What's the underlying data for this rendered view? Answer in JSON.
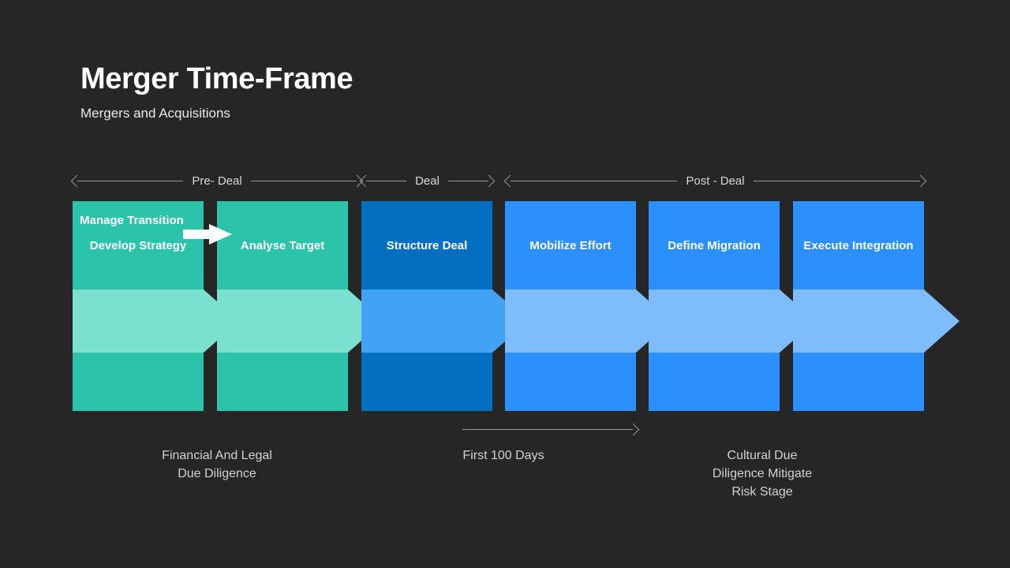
{
  "header": {
    "title": "Merger Time-Frame",
    "subtitle": "Mergers and Acquisitions"
  },
  "colors": {
    "background": "#262626",
    "teal": "#2BC4AB",
    "teal_light": "#7CE0D0",
    "blue_dark": "#046FC0",
    "blue_dark_light": "#42A3F5",
    "blue": "#2B8FFC",
    "blue_light": "#7FBCFB",
    "text_muted": "#d2d2d2",
    "rule": "#9b9b9b"
  },
  "phases": [
    {
      "label": "Pre- Deal"
    },
    {
      "label": "Deal"
    },
    {
      "label": "Post - Deal"
    }
  ],
  "stages": [
    {
      "title": "Develop\nStrategy",
      "fill": "#2BC4AB",
      "band": "#7CE0D0"
    },
    {
      "title": "Analyse\nTarget",
      "fill": "#2BC4AB",
      "band": "#7CE0D0"
    },
    {
      "title": "Structure\nDeal",
      "fill": "#046FC0",
      "band": "#42A3F5"
    },
    {
      "title": "Mobilize\nEffort",
      "fill": "#2B8FFC",
      "band": "#7FBCFB"
    },
    {
      "title": "Define\nMigration",
      "fill": "#2B8FFC",
      "band": "#7FBCFB"
    },
    {
      "title": "Execute\nIntegration",
      "fill": "#2B8FFC",
      "band": "#7FBCFB"
    }
  ],
  "band_label": "Manage\nTransition",
  "captions": [
    {
      "text": "Financial And Legal\nDue Diligence"
    },
    {
      "text": "First 100 Days"
    },
    {
      "text": "Cultural Due\nDiligence Mitigate\nRisk Stage"
    }
  ]
}
